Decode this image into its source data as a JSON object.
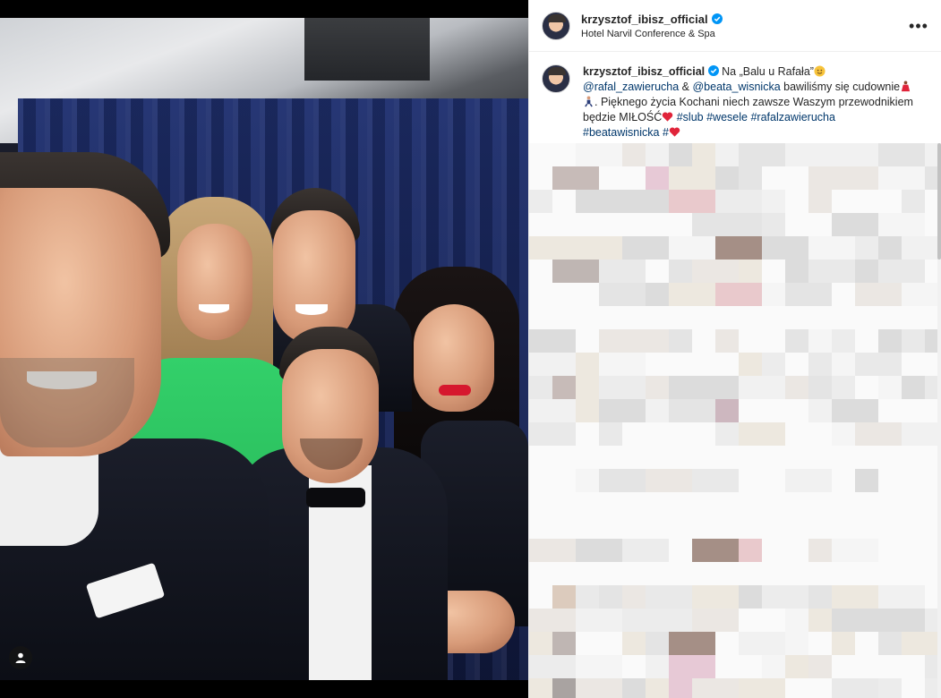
{
  "post": {
    "username": "krzysztof_ibisz_official",
    "location": "Hotel Narvil Conference & Spa",
    "more_icon": "more-horizontal-icon",
    "verified_color": "#0095f6"
  },
  "caption": {
    "username": "krzysztof_ibisz_official",
    "part1": " Na „Balu u Rafała”",
    "mention1": "@rafal_zawierucha",
    "amp": " & ",
    "mention2": "@beata_wisnicka",
    "part2": " bawiliśmy się cudownie",
    "part3": ". Pięknego życia Kochani niech zawsze Waszym przewodnikiem będzie MIŁOŚĆ",
    "hashtags": [
      "#slub",
      "#wesele",
      "#rafalzawierucha",
      "#beatawisnicka",
      "#"
    ],
    "emojis": [
      "smiling-face-icon",
      "dancer-icon",
      "dancing-man-icon",
      "red-heart-icon",
      "red-heart-icon"
    ]
  },
  "photo": {
    "tagged_icon": "user-tag-icon"
  },
  "colors": {
    "link": "#00376b",
    "text": "#262626",
    "heart": "#e0243a"
  }
}
